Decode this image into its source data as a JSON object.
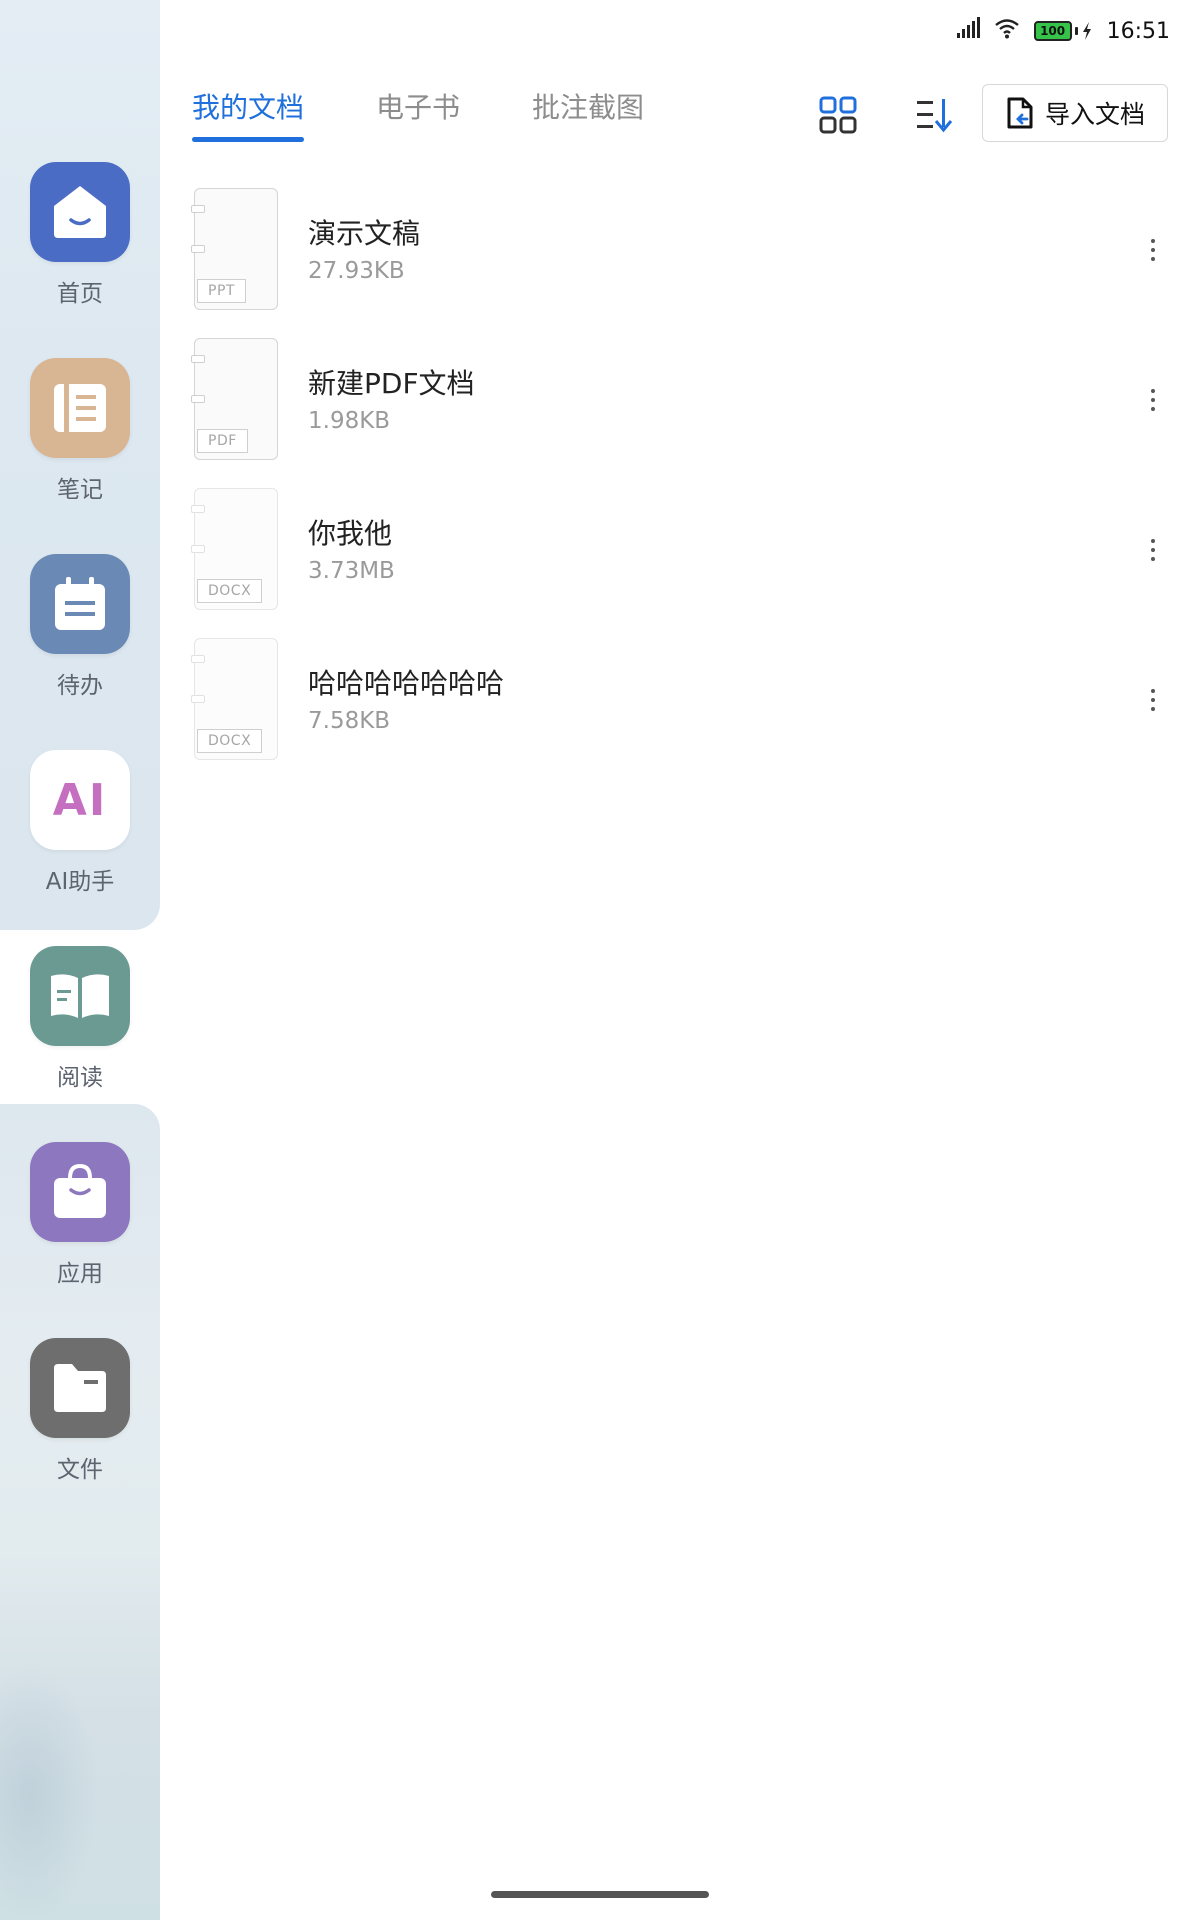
{
  "status_bar": {
    "time": "16:51",
    "battery": "100"
  },
  "sidebar": {
    "items": [
      {
        "label": "首页",
        "icon": "home-icon",
        "color": "#4a6cc4"
      },
      {
        "label": "笔记",
        "icon": "notebook-icon",
        "color": "#d8b593"
      },
      {
        "label": "待办",
        "icon": "todo-icon",
        "color": "#6a8ab5"
      },
      {
        "label": "AI助手",
        "icon": "ai-icon",
        "color": "#ffffff"
      },
      {
        "label": "阅读",
        "icon": "book-icon",
        "color": "#6a9a92"
      },
      {
        "label": "应用",
        "icon": "shopping-bag-icon",
        "color": "#8d78c0"
      },
      {
        "label": "文件",
        "icon": "folder-icon",
        "color": "#6e6e6e"
      }
    ],
    "ai_text": "AI"
  },
  "tabs": [
    {
      "label": "我的文档",
      "active": true
    },
    {
      "label": "电子书",
      "active": false
    },
    {
      "label": "批注截图",
      "active": false
    }
  ],
  "toolbar": {
    "grid_icon": "grid-view-icon",
    "sort_icon": "sort-icon",
    "import_label": "导入文档"
  },
  "documents": [
    {
      "name": "演示文稿",
      "size": "27.93KB",
      "type": "PPT"
    },
    {
      "name": "新建PDF文档",
      "size": "1.98KB",
      "type": "PDF"
    },
    {
      "name": "你我他",
      "size": "3.73MB",
      "type": "DOCX"
    },
    {
      "name": "哈哈哈哈哈哈哈",
      "size": "7.58KB",
      "type": "DOCX"
    }
  ],
  "accent_color": "#1f6fdc"
}
